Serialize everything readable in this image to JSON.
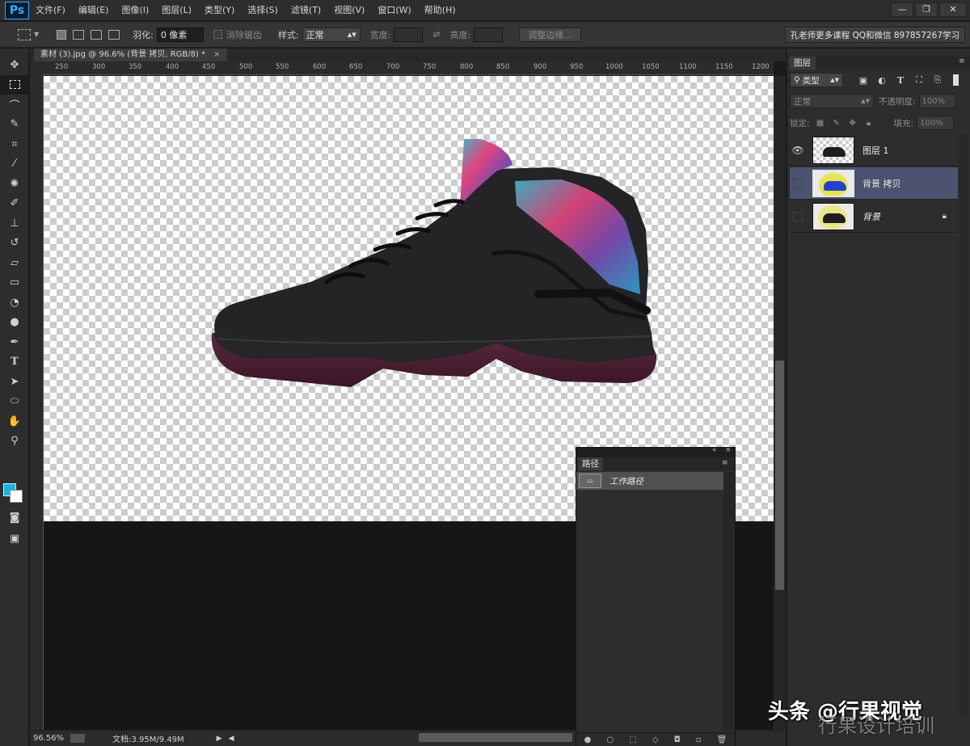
{
  "app": {
    "logo": "Ps",
    "menu": [
      "文件(F)",
      "编辑(E)",
      "图像(I)",
      "图层(L)",
      "类型(Y)",
      "选择(S)",
      "滤镜(T)",
      "视图(V)",
      "窗口(W)",
      "帮助(H)"
    ],
    "window_controls": [
      "—",
      "❐",
      "✕"
    ]
  },
  "options": {
    "feather_label": "羽化:",
    "feather_value": "0 像素",
    "antialias_label": "消除锯齿",
    "style_label": "样式:",
    "style_value": "正常",
    "width_label": "宽度:",
    "height_label": "高度:",
    "refine_edge": "调整边缘...",
    "promo": "孔老师更多课程 QQ和微信 897857267学习"
  },
  "document": {
    "tab_title": "素材 (3).jpg @ 96.6% (背景 拷贝, RGB/8) *",
    "ruler_ticks": [
      "250",
      "300",
      "350",
      "400",
      "450",
      "500",
      "550",
      "600",
      "650",
      "700",
      "750",
      "800",
      "850",
      "900",
      "950",
      "1000",
      "1050",
      "1100",
      "1150",
      "1200"
    ],
    "zoom": "96.56%",
    "doc_info": "文档:3.95M/9.49M"
  },
  "colors": {
    "foreground": "#17b4e6",
    "background": "#ffffff"
  },
  "layers_panel": {
    "tab": "图层",
    "filter_kind": "类型",
    "blend_mode": "正常",
    "opacity_label": "不透明度:",
    "opacity_value": "100%",
    "lock_label": "锁定:",
    "fill_label": "填充:",
    "fill_value": "100%",
    "layers": [
      {
        "name": "图层 1",
        "visible": true,
        "selected": false,
        "locked": false
      },
      {
        "name": "背景 拷贝",
        "visible": false,
        "selected": true,
        "locked": false
      },
      {
        "name": "背景",
        "visible": false,
        "selected": false,
        "locked": true
      }
    ]
  },
  "paths_panel": {
    "tab": "路径",
    "paths": [
      {
        "name": "工作路径"
      }
    ]
  },
  "watermark": {
    "line1": "头条 @行果视觉",
    "line2": "行果设计培训"
  }
}
